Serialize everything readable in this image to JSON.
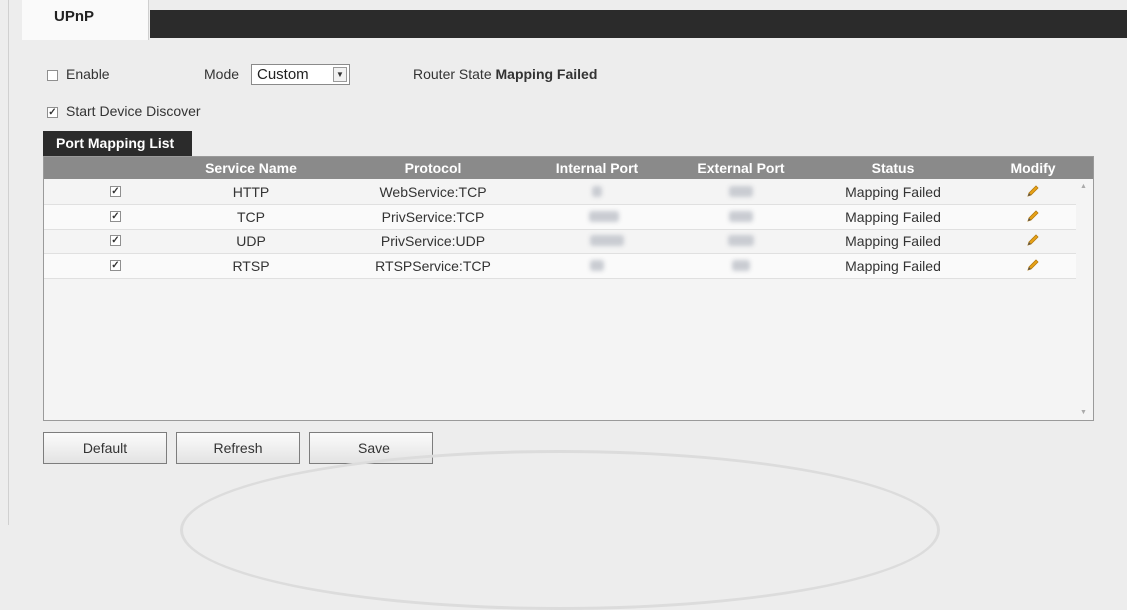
{
  "top_tab": {
    "label": "UPnP"
  },
  "settings": {
    "enable_label": "Enable",
    "enable_checked": false,
    "mode_label": "Mode",
    "mode_value": "Custom",
    "router_state_label": "Router State",
    "router_state_value": "Mapping Failed",
    "start_discover_label": "Start Device Discover",
    "start_discover_checked": true
  },
  "port_mapping": {
    "title": "Port Mapping List",
    "columns": [
      "Service Name",
      "Protocol",
      "Internal Port",
      "External Port",
      "Status",
      "Modify"
    ],
    "rows": [
      {
        "checked": true,
        "service": "HTTP",
        "protocol": "WebService:TCP",
        "status": "Mapping Failed"
      },
      {
        "checked": true,
        "service": "TCP",
        "protocol": "PrivService:TCP",
        "status": "Mapping Failed"
      },
      {
        "checked": true,
        "service": "UDP",
        "protocol": "PrivService:UDP",
        "status": "Mapping Failed"
      },
      {
        "checked": true,
        "service": "RTSP",
        "protocol": "RTSPService:TCP",
        "status": "Mapping Failed"
      }
    ]
  },
  "buttons": {
    "default": "Default",
    "refresh": "Refresh",
    "save": "Save"
  },
  "colors": {
    "tab_dark": "#2b2b2b",
    "header_gray": "#8a8a8a",
    "pencil": "#e8a317",
    "background": "#ededed"
  },
  "icons": {
    "modify": "pencil-icon",
    "dropdown": "chevron-down-icon"
  }
}
